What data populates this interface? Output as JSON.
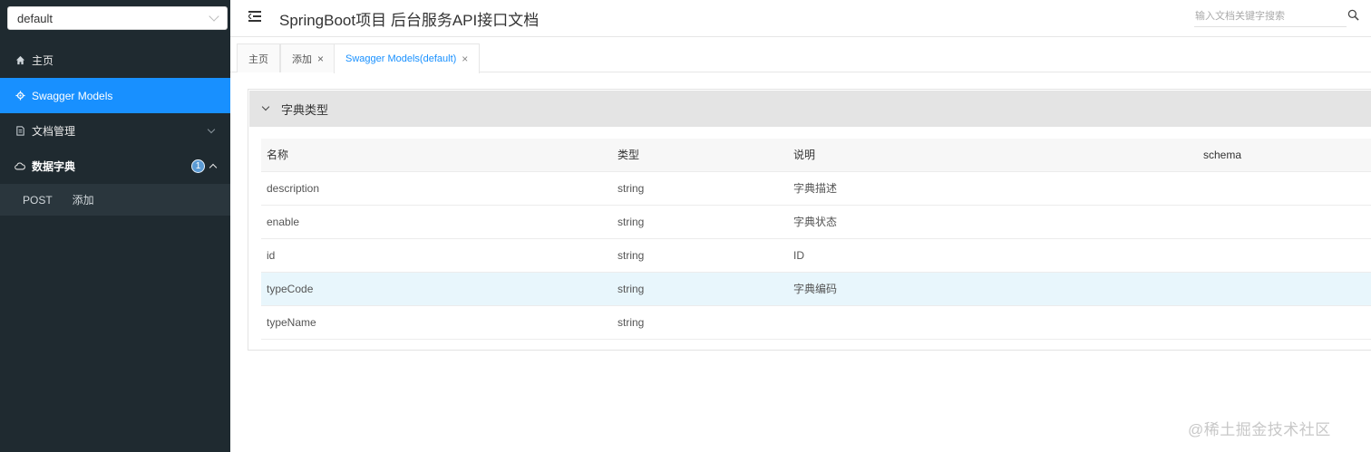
{
  "sidebar": {
    "group_select": {
      "value": "default"
    },
    "items": [
      {
        "label": "主页",
        "icon": "home-icon"
      },
      {
        "label": "Swagger Models",
        "icon": "gear-icon"
      },
      {
        "label": "文档管理",
        "icon": "document-icon"
      },
      {
        "label": "数据字典",
        "icon": "cloud-icon",
        "badge": "1"
      }
    ],
    "submenu": [
      {
        "method": "POST",
        "label": "添加"
      }
    ]
  },
  "header": {
    "title": "SpringBoot项目 后台服务API接口文档",
    "search_placeholder": "输入文档关键字搜索"
  },
  "tabs": [
    {
      "label": "主页",
      "closable": false
    },
    {
      "label": "添加",
      "closable": true,
      "close": "×"
    },
    {
      "label": "Swagger Models(default)",
      "closable": true,
      "close": "×",
      "active": true
    }
  ],
  "model": {
    "title": "字典类型",
    "columns": [
      "名称",
      "类型",
      "说明",
      "schema"
    ],
    "rows": [
      {
        "name": "description",
        "type": "string",
        "desc": "字典描述",
        "schema": ""
      },
      {
        "name": "enable",
        "type": "string",
        "desc": "字典状态",
        "schema": ""
      },
      {
        "name": "id",
        "type": "string",
        "desc": "ID",
        "schema": ""
      },
      {
        "name": "typeCode",
        "type": "string",
        "desc": "字典编码",
        "schema": "",
        "highlight": true
      },
      {
        "name": "typeName",
        "type": "string",
        "desc": "",
        "schema": ""
      }
    ]
  },
  "watermark": "@稀土掘金技术社区",
  "colors": {
    "sidebar_bg": "#1f2a30",
    "accent": "#1890ff",
    "row_highlight": "#e8f6fc"
  }
}
